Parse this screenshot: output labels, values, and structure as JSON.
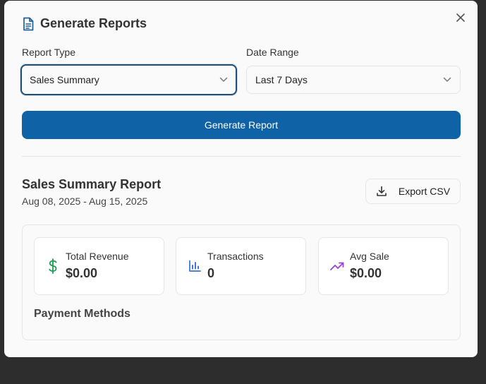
{
  "dialog": {
    "title": "Generate Reports",
    "icon": "document-icon"
  },
  "form": {
    "report_type_label": "Report Type",
    "report_type_value": "Sales Summary",
    "date_range_label": "Date Range",
    "date_range_value": "Last 7 Days",
    "generate_label": "Generate Report"
  },
  "report": {
    "title": "Sales Summary Report",
    "range": "Aug 08, 2025 - Aug 15, 2025",
    "export_label": "Export CSV",
    "stats": [
      {
        "label": "Total Revenue",
        "value": "$0.00",
        "icon": "dollar-icon",
        "color": "#1f9d55"
      },
      {
        "label": "Transactions",
        "value": "0",
        "icon": "bar-chart-icon",
        "color": "#3b6fd6"
      },
      {
        "label": "Avg Sale",
        "value": "$0.00",
        "icon": "trending-up-icon",
        "color": "#9b3fd6"
      }
    ],
    "payment_methods_label": "Payment Methods"
  },
  "colors": {
    "primary": "#0f62a5",
    "overlay": "#2d2d2d",
    "panel": "#fafafa"
  }
}
